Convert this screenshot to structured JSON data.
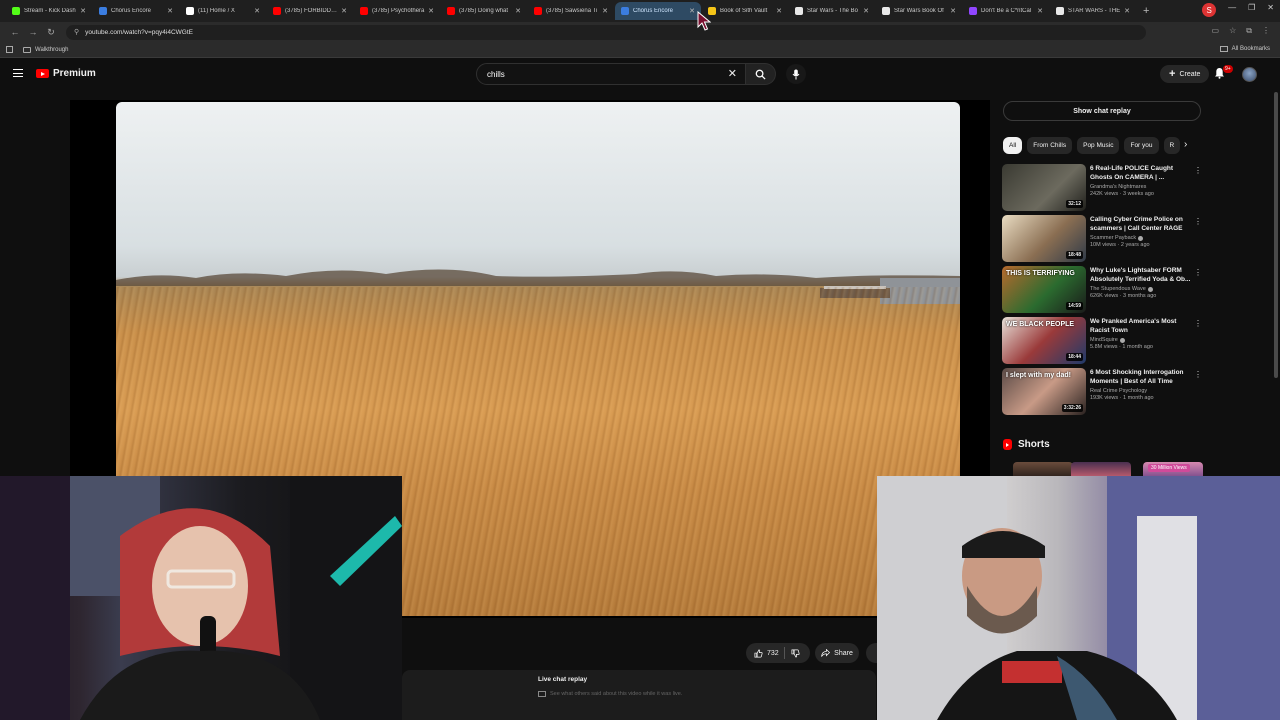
{
  "browser": {
    "tabs": [
      {
        "title": "Stream - Kick Dash",
        "color": "#53fc18"
      },
      {
        "title": "Chorus Encore",
        "color": "#3b7de0"
      },
      {
        "title": "(11) Home / X",
        "color": "#ffffff"
      },
      {
        "title": "(3785) FORBIDDEN",
        "color": "#ff0000"
      },
      {
        "title": "(3785) Psychothera",
        "color": "#ff0000"
      },
      {
        "title": "(3785) Doing what",
        "color": "#ff0000"
      },
      {
        "title": "(3785) Sawsiena Ti",
        "color": "#ff0000"
      },
      {
        "title": "Chorus Encore",
        "color": "#3b7de0",
        "active": true
      },
      {
        "title": "Book of Sith Vault",
        "color": "#f5c518"
      },
      {
        "title": "Star Wars - The Bo",
        "color": "#e8e8e8"
      },
      {
        "title": "Star Wars Book Of",
        "color": "#e8e8e8"
      },
      {
        "title": "Don't Be a C*ntCal",
        "color": "#9146ff"
      },
      {
        "title": "STAR WARS - THE",
        "color": "#e8e8e8"
      }
    ],
    "new_tab": "+",
    "url": "youtube.com/watch?v=pqy4i4CWGtE",
    "bookmark_folder": "Walkthrough",
    "all_bookmarks": "All Bookmarks",
    "profile_initial": "S"
  },
  "youtube": {
    "logo_text": "Premium",
    "search_value": "chills",
    "create_label": "Create",
    "notif_badge": "9+",
    "show_chat_replay": "Show chat replay",
    "chips": [
      "All",
      "From Chills",
      "Pop Music",
      "For you",
      "R"
    ],
    "recommendations": [
      {
        "title": "6 Real-Life POLICE Caught Ghosts On CAMERA | ...",
        "channel": "Grandma's Nightmares",
        "meta": "242K views · 3 weeks ago",
        "duration": "32:12",
        "thumb_text": "",
        "verified": false
      },
      {
        "title": "Calling Cyber Crime Police on scammers | Call Center RAGE",
        "channel": "Scammer Payback",
        "meta": "10M views · 2 years ago",
        "duration": "18:48",
        "thumb_text": "",
        "verified": true
      },
      {
        "title": "Why Luke's Lightsaber FORM Absolutely Terrified Yoda & Ob...",
        "channel": "The Stupendous Wave",
        "meta": "626K views · 3 months ago",
        "duration": "14:59",
        "thumb_text": "THIS IS TERRIFYING",
        "verified": true
      },
      {
        "title": "We Pranked America's Most Racist Town",
        "channel": "MindSquire",
        "meta": "5.8M views · 1 month ago",
        "duration": "18:44",
        "thumb_text": "WE BLACK PEOPLE",
        "verified": true
      },
      {
        "title": "6 Most Shocking Interrogation Moments | Best of All Time",
        "channel": "Real Crime Psychology",
        "meta": "193K views · 1 month ago",
        "duration": "3:32:26",
        "thumb_text": "I slept with my dad!",
        "verified": false
      }
    ],
    "shorts_label": "Shorts",
    "short_badge": "30 Million Views",
    "likes": "732",
    "share_label": "Share",
    "live_chat_title": "Live chat replay",
    "live_chat_sub": "See what others said about this video while it was live."
  }
}
